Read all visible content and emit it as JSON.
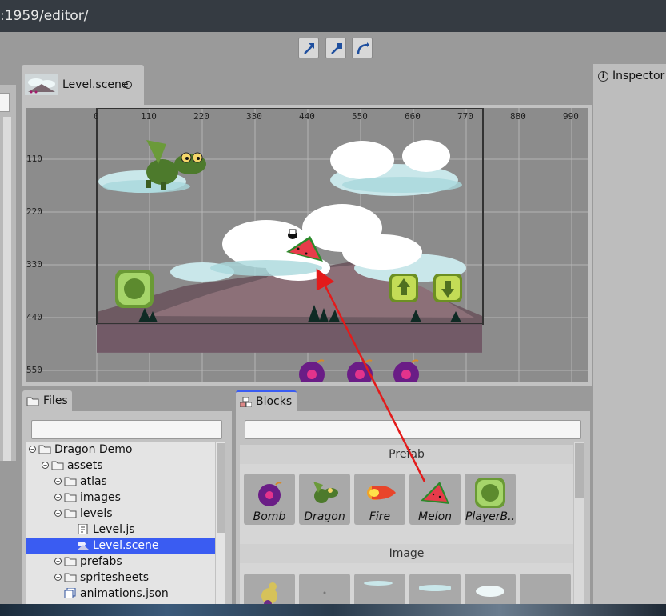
{
  "browser": {
    "url": ":1959/editor/"
  },
  "toolbar": {
    "tools": [
      "translate-tool",
      "scale-tool",
      "rotate-tool"
    ]
  },
  "editor": {
    "tab_title": "Level.scene",
    "ruler_x": [
      "0",
      "110",
      "220",
      "330",
      "440",
      "550",
      "660",
      "770",
      "880",
      "990"
    ],
    "ruler_y": [
      "110",
      "220",
      "330",
      "440",
      "550"
    ]
  },
  "inspector": {
    "title": "Inspector"
  },
  "files": {
    "tab_label": "Files",
    "search_placeholder": "",
    "tree": [
      {
        "label": "Dragon Demo",
        "depth": 0,
        "type": "folder",
        "expanded": true
      },
      {
        "label": "assets",
        "depth": 1,
        "type": "folder",
        "expanded": true
      },
      {
        "label": "atlas",
        "depth": 2,
        "type": "folder",
        "expanded": false
      },
      {
        "label": "images",
        "depth": 2,
        "type": "folder",
        "expanded": false
      },
      {
        "label": "levels",
        "depth": 2,
        "type": "folder",
        "expanded": true
      },
      {
        "label": "Level.js",
        "depth": 3,
        "type": "js"
      },
      {
        "label": "Level.scene",
        "depth": 3,
        "type": "scene",
        "selected": true
      },
      {
        "label": "prefabs",
        "depth": 2,
        "type": "folder",
        "expanded": false
      },
      {
        "label": "spritesheets",
        "depth": 2,
        "type": "folder",
        "expanded": false
      },
      {
        "label": "animations.json",
        "depth": 2,
        "type": "json"
      }
    ]
  },
  "blocks": {
    "tab_label": "Blocks",
    "search_placeholder": "",
    "prefab_header": "Prefab",
    "prefabs": [
      {
        "label": "Bomb",
        "icon": "bomb-icon"
      },
      {
        "label": "Dragon",
        "icon": "dragon-icon"
      },
      {
        "label": "Fire",
        "icon": "fire-icon"
      },
      {
        "label": "Melon",
        "icon": "melon-icon"
      },
      {
        "label": "PlayerB..",
        "icon": "player-button-icon"
      }
    ],
    "image_header": "Image"
  },
  "colors": {
    "selection": "#3a5cf2",
    "drag_arrow": "#e31b1b"
  }
}
